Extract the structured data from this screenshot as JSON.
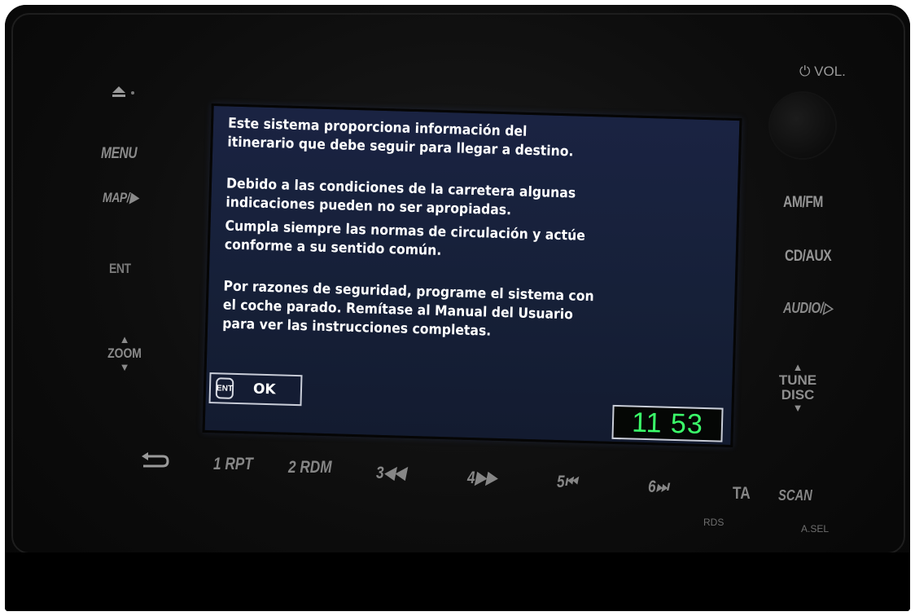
{
  "left_controls": {
    "menu": "MENU",
    "map": "MAP/▶",
    "ent": "ENT",
    "zoom": "ZOOM",
    "eject_icon": "eject-icon"
  },
  "right_controls": {
    "vol": "⏻ VOL.",
    "amfm": "AM/FM",
    "cdaux": "CD/AUX",
    "audio": "AUDIO/▷",
    "tune_line1": "TUNE",
    "tune_line2": "DISC"
  },
  "screen": {
    "paragraphs": [
      [
        "Este sistema proporciona información del",
        "itinerario que debe seguir para llegar a destino."
      ],
      [
        "Debido a las condiciones de la carretera algunas",
        "indicaciones pueden no ser apropiadas."
      ],
      [
        "Cumpla siempre las normas de circulación y actúe",
        "conforme a su sentido común."
      ],
      [
        "Por razones de seguridad, programe el sistema con",
        "el coche parado. Remítase al Manual del Usuario",
        "para ver las instrucciones completas."
      ]
    ],
    "ok_icon_text": "ENT",
    "ok_label": "OK",
    "clock": "11 53"
  },
  "presets": {
    "back_icon": "back-arrow-icon",
    "p1": "1 RPT",
    "p2": "2 RDM",
    "p3": "3◀◀",
    "p4": "4▶▶",
    "p5": "5⏮",
    "p6": "6⏭",
    "ta": "TA",
    "rds": "RDS",
    "scan": "SCAN",
    "asel": "A.SEL"
  }
}
